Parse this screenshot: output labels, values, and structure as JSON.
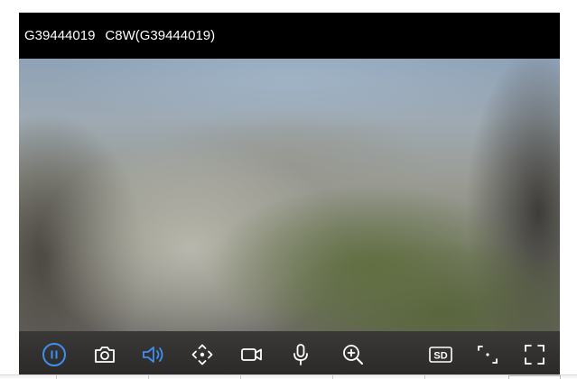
{
  "header": {
    "device_id": "G39444019",
    "device_name": "C8W(G39444019)"
  },
  "controls": {
    "accent_color": "#3d8ff0",
    "icon_color": "#ffffff",
    "buttons": [
      {
        "name": "pause-icon",
        "state": "active"
      },
      {
        "name": "camera-snapshot-icon",
        "state": "normal"
      },
      {
        "name": "speaker-volume-icon",
        "state": "active"
      },
      {
        "name": "ptz-direction-icon",
        "state": "normal"
      },
      {
        "name": "video-record-icon",
        "state": "normal"
      },
      {
        "name": "microphone-icon",
        "state": "normal"
      },
      {
        "name": "zoom-in-icon",
        "state": "normal"
      },
      {
        "name": "sd-quality-icon",
        "state": "normal"
      },
      {
        "name": "focus-frame-icon",
        "state": "normal"
      },
      {
        "name": "fullscreen-icon",
        "state": "normal"
      }
    ],
    "quality_label": "SD"
  }
}
